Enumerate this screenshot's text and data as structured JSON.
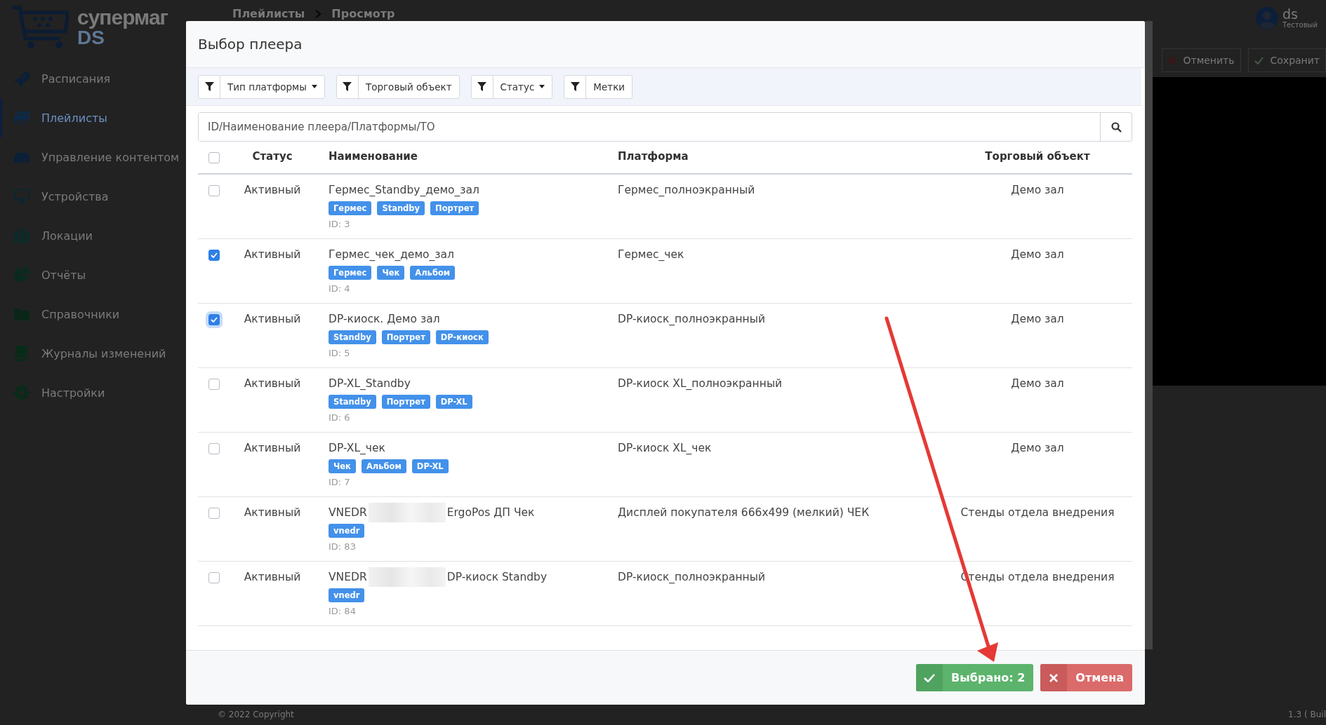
{
  "app": {
    "logo": {
      "title": "супермаг",
      "subtitle": "DS"
    },
    "sidebar": {
      "items": [
        {
          "label": "Расписания",
          "selected": false
        },
        {
          "label": "Плейлисты",
          "selected": true
        },
        {
          "label": "Управление контентом",
          "selected": false
        },
        {
          "label": "Устройства",
          "selected": false
        },
        {
          "label": "Локации",
          "selected": false
        },
        {
          "label": "Отчёты",
          "selected": false
        },
        {
          "label": "Справочники",
          "selected": false
        },
        {
          "label": "Журналы изменений",
          "selected": false
        },
        {
          "label": "Настройки",
          "selected": false
        }
      ]
    },
    "breadcrumb": [
      "Плейлисты",
      "Просмотр"
    ],
    "user": {
      "name": "ds",
      "role": "Тестовый"
    },
    "toolbar": {
      "buttons": [
        {
          "kind": "cancel",
          "label": "Отменить"
        },
        {
          "kind": "save",
          "label": "Сохранит"
        }
      ]
    },
    "footer": {
      "copyright": "© 2022 Copyright",
      "version": "1.3 ( Buil"
    }
  },
  "modal": {
    "title": "Выбор плеера",
    "filters": [
      {
        "label": "Тип платформы",
        "dropdown": true
      },
      {
        "label": "Торговый объект",
        "dropdown": false
      },
      {
        "label": "Статус",
        "dropdown": true
      },
      {
        "label": "Метки",
        "dropdown": false
      }
    ],
    "search": {
      "placeholder": "ID/Наименование плеера/Платформы/ТО"
    },
    "table": {
      "select_all": false,
      "columns": [
        "Статус",
        "Наименование",
        "Платформа",
        "Торговый объект"
      ],
      "rows": [
        {
          "checked": false,
          "status": "Активный",
          "name": "Гермес_Standby_демо_зал",
          "tags": [
            "Гермес",
            "Standby",
            "Портрет"
          ],
          "id": "ID: 3",
          "platform": "Гермес_полноэкранный",
          "store": "Демо зал"
        },
        {
          "checked": true,
          "status": "Активный",
          "name": "Гермес_чек_демо_зал",
          "tags": [
            "Гермес",
            "Чек",
            "Альбом"
          ],
          "id": "ID: 4",
          "platform": "Гермес_чек",
          "store": "Демо зал"
        },
        {
          "checked": true,
          "focused": true,
          "status": "Активный",
          "name": "DP-киоск. Демо зал",
          "tags": [
            "Standby",
            "Портрет",
            "DP-киоск"
          ],
          "id": "ID: 5",
          "platform": "DP-киоск_полноэкранный",
          "store": "Демо зал"
        },
        {
          "checked": false,
          "status": "Активный",
          "name": "DP-XL_Standby",
          "tags": [
            "Standby",
            "Портрет",
            "DP-XL"
          ],
          "id": "ID: 6",
          "platform": "DP-киоск XL_полноэкранный",
          "store": "Демо зал"
        },
        {
          "checked": false,
          "status": "Активный",
          "name": "DP-XL_чек",
          "tags": [
            "Чек",
            "Альбом",
            "DP-XL"
          ],
          "id": "ID: 7",
          "platform": "DP-киоск XL_чек",
          "store": "Демо зал"
        },
        {
          "checked": false,
          "status": "Активный",
          "name": "VNEDR",
          "redacted": true,
          "name_rest": "ErgoPos ДП Чек",
          "tags": [
            "vnedr"
          ],
          "id": "ID: 83",
          "platform": "Дисплей покупателя 666x499 (мелкий) ЧЕК",
          "store": "Стенды отдела внедрения"
        },
        {
          "checked": false,
          "status": "Активный",
          "name": "VNEDR",
          "redacted": true,
          "name_rest": "DP-киоск Standby",
          "tags": [
            "vnedr"
          ],
          "id": "ID: 84",
          "platform": "DP-киоск_полноэкранный",
          "store": "Стенды отдела внедрения"
        }
      ]
    },
    "buttons": [
      {
        "kind": "confirm",
        "label": "Выбрано: 2"
      },
      {
        "kind": "cancel",
        "label": "Отмена"
      }
    ]
  }
}
